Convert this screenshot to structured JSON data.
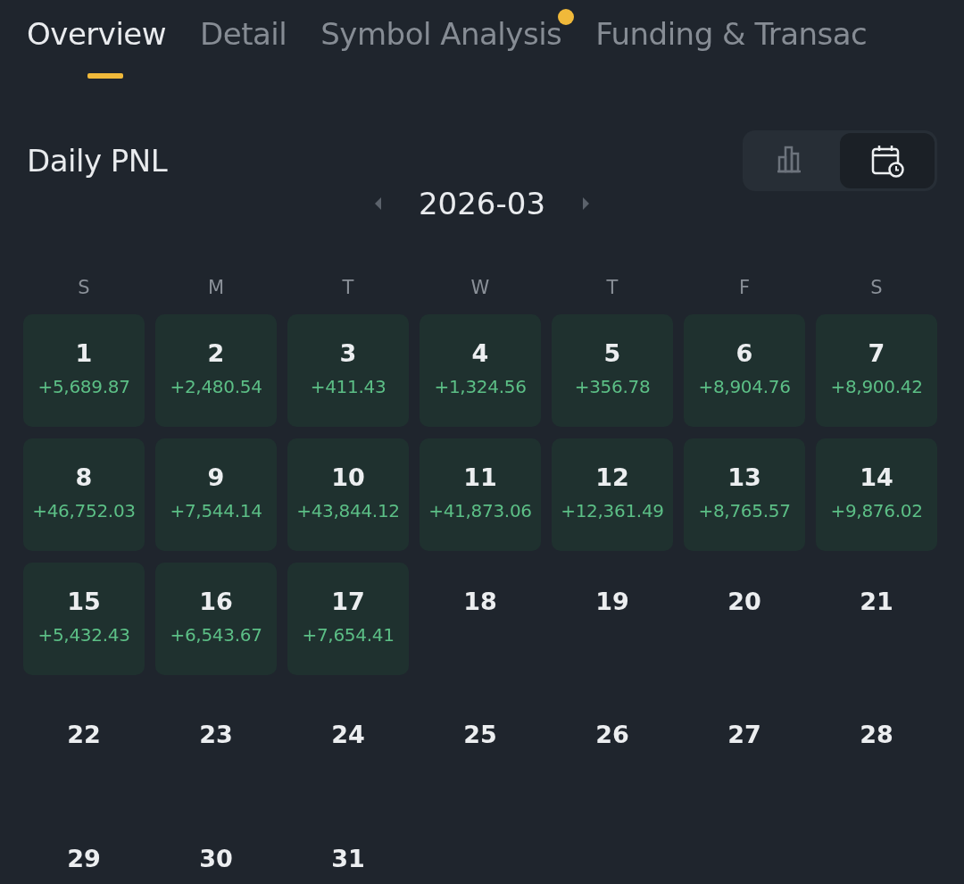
{
  "tabs": [
    {
      "label": "Overview",
      "selected": true,
      "dot": false
    },
    {
      "label": "Detail",
      "selected": false,
      "dot": false
    },
    {
      "label": "Symbol Analysis",
      "selected": false,
      "dot": true
    },
    {
      "label": "Funding & Transac",
      "selected": false,
      "dot": false
    }
  ],
  "section_title": "Daily PNL",
  "view_toggle": [
    {
      "kind": "chart",
      "selected": false
    },
    {
      "kind": "calendar",
      "selected": true
    }
  ],
  "month": "2026-03",
  "weekdays": [
    "S",
    "M",
    "T",
    "W",
    "T",
    "F",
    "S"
  ],
  "days": [
    {
      "day": "1",
      "pnl": "+5,689.87"
    },
    {
      "day": "2",
      "pnl": "+2,480.54"
    },
    {
      "day": "3",
      "pnl": "+411.43"
    },
    {
      "day": "4",
      "pnl": "+1,324.56"
    },
    {
      "day": "5",
      "pnl": "+356.78"
    },
    {
      "day": "6",
      "pnl": "+8,904.76"
    },
    {
      "day": "7",
      "pnl": "+8,900.42"
    },
    {
      "day": "8",
      "pnl": "+46,752.03"
    },
    {
      "day": "9",
      "pnl": "+7,544.14"
    },
    {
      "day": "10",
      "pnl": "+43,844.12"
    },
    {
      "day": "11",
      "pnl": "+41,873.06"
    },
    {
      "day": "12",
      "pnl": "+12,361.49"
    },
    {
      "day": "13",
      "pnl": "+8,765.57"
    },
    {
      "day": "14",
      "pnl": "+9,876.02"
    },
    {
      "day": "15",
      "pnl": "+5,432.43"
    },
    {
      "day": "16",
      "pnl": "+6,543.67"
    },
    {
      "day": "17",
      "pnl": "+7,654.41"
    },
    {
      "day": "18"
    },
    {
      "day": "19"
    },
    {
      "day": "20"
    },
    {
      "day": "21"
    },
    {
      "day": "22"
    },
    {
      "day": "23"
    },
    {
      "day": "24"
    },
    {
      "day": "25"
    },
    {
      "day": "26"
    },
    {
      "day": "27"
    },
    {
      "day": "28"
    },
    {
      "day": "29"
    },
    {
      "day": "30"
    },
    {
      "day": "31"
    }
  ]
}
